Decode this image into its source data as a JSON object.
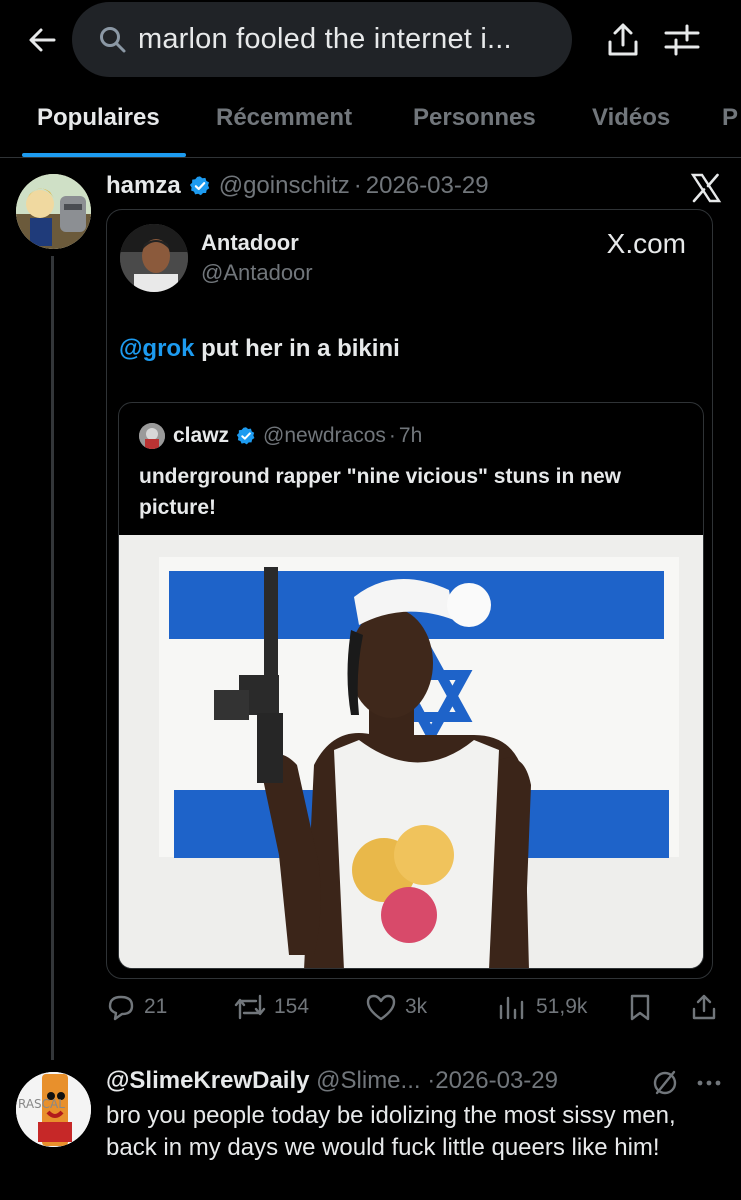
{
  "search": {
    "query": "marlon fooled the internet i..."
  },
  "tabs": [
    {
      "label": "Populaires"
    },
    {
      "label": "Récemment"
    },
    {
      "label": "Personnes"
    },
    {
      "label": "Vidéos"
    },
    {
      "label": "P"
    }
  ],
  "tweet1": {
    "name": "hamza",
    "handle": "@goinschitz",
    "separator": "·",
    "date": "2026-03-29",
    "card": {
      "name": "Antadoor",
      "handle": "@Antadoor",
      "source": "X.com",
      "mention": "@grok",
      "text": " put her in a bikini",
      "quote": {
        "name": "clawz",
        "handle": "@newdracos",
        "separator": "·",
        "time": "7h",
        "text": "underground rapper \"nine vicious\" stuns in new picture!"
      }
    },
    "stats": {
      "replies": "21",
      "reposts": "154",
      "likes": "3k",
      "views": "51,9k"
    }
  },
  "tweet2": {
    "name": "@SlimeKrewDaily",
    "handle": "@Slime...",
    "separator": "·",
    "date": "2026-03-29",
    "text": "bro you people today be idolizing the most sissy men, back in my days we would fuck little queers like him!",
    "avatar_text": "RASCAL"
  },
  "colors": {
    "accent": "#1d9bf0",
    "muted": "#71767b",
    "background": "#000000"
  }
}
